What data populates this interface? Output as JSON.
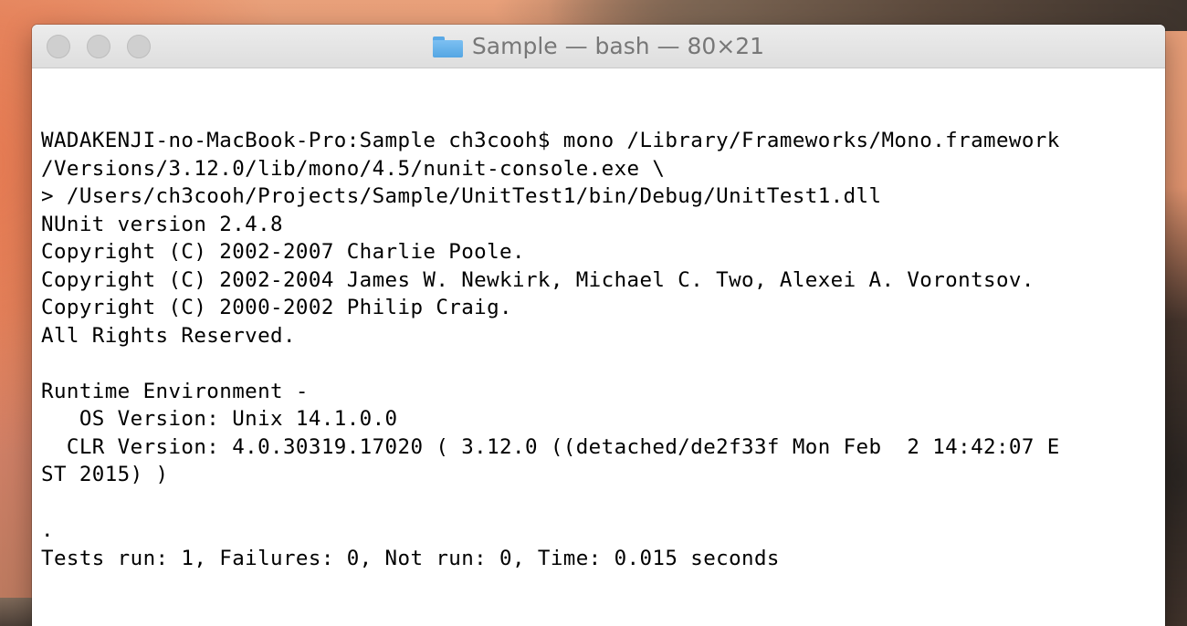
{
  "window": {
    "title": "Sample — bash — 80×21",
    "icon": "folder-icon"
  },
  "terminal": {
    "lines": [
      "WADAKENJI-no-MacBook-Pro:Sample ch3cooh$ mono /Library/Frameworks/Mono.framework",
      "/Versions/3.12.0/lib/mono/4.5/nunit-console.exe \\",
      "> /Users/ch3cooh/Projects/Sample/UnitTest1/bin/Debug/UnitTest1.dll",
      "NUnit version 2.4.8",
      "Copyright (C) 2002-2007 Charlie Poole.",
      "Copyright (C) 2002-2004 James W. Newkirk, Michael C. Two, Alexei A. Vorontsov.",
      "Copyright (C) 2000-2002 Philip Craig.",
      "All Rights Reserved.",
      "",
      "Runtime Environment -",
      "   OS Version: Unix 14.1.0.0",
      "  CLR Version: 4.0.30319.17020 ( 3.12.0 ((detached/de2f33f Mon Feb  2 14:42:07 E",
      "ST 2015) )",
      "",
      ".",
      "Tests run: 1, Failures: 0, Not run: 0, Time: 0.015 seconds"
    ]
  }
}
